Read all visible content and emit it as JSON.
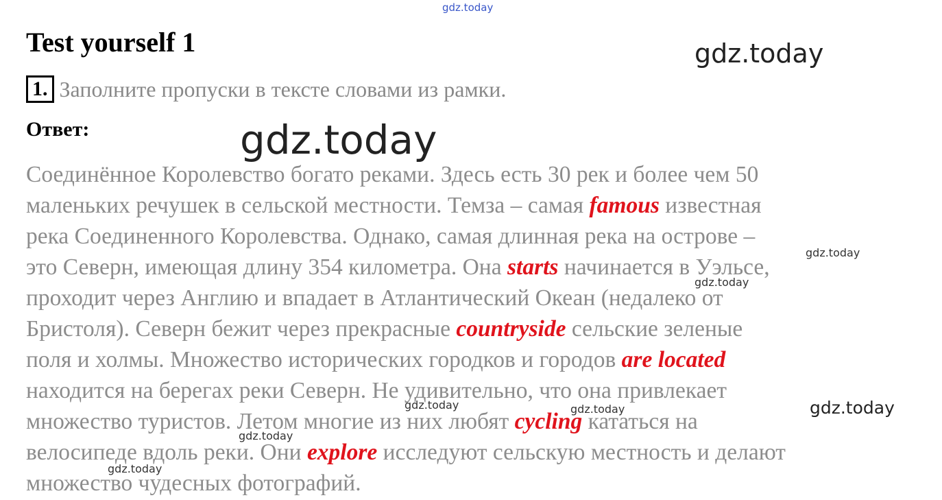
{
  "watermarks": {
    "top": "gdz.today",
    "big1": "gdz.today",
    "big2": "gdz.today",
    "small": [
      "gdz.today",
      "gdz.today",
      "gdz.today",
      "gdz.today",
      "gdz.today",
      "gdz.today",
      "gdz.today"
    ]
  },
  "title": "Test yourself 1",
  "task": {
    "number": "1.",
    "instruction": "Заполните пропуски в тексте словами из рамки."
  },
  "answer_label": "Ответ:",
  "lines": [
    {
      "before": "Соединённое Королевство богато реками. Здесь есть 30 рек и более чем 50"
    },
    {
      "before": "маленьких речушек в сельской местности. Темза – самая ",
      "word": "famous",
      "after": " известная"
    },
    {
      "before": "река Соединенного Королевства. Однако, самая длинная река на острове –"
    },
    {
      "before": "это Северн, имеющая длину 354 километра. Она ",
      "word": "starts",
      "after": " начинается в Уэльсе,"
    },
    {
      "before": "проходит через Англию и впадает в Атлантический Океан (недалеко от"
    },
    {
      "before": "Бристоля). Северн бежит через прекрасные ",
      "word": "countryside",
      "after": " сельские зеленые"
    },
    {
      "before": "поля и холмы. Множество исторических городков и городов ",
      "word": "are located"
    },
    {
      "before": "находится на берегах реки Северн. Не удивительно, что она привлекает"
    },
    {
      "before": "множество туристов. Летом многие из них любят ",
      "word": "cycling",
      "after": " кататься на"
    },
    {
      "before": "велосипеде вдоль реки. Они ",
      "word": "explore",
      "after": " исследуют сельскую местность и делают"
    },
    {
      "before": "множество чудесных фотографий."
    }
  ],
  "colors": {
    "answer_words": "#e0131c",
    "body_text": "#8c8c8c",
    "watermark_link": "#3a57c9"
  }
}
